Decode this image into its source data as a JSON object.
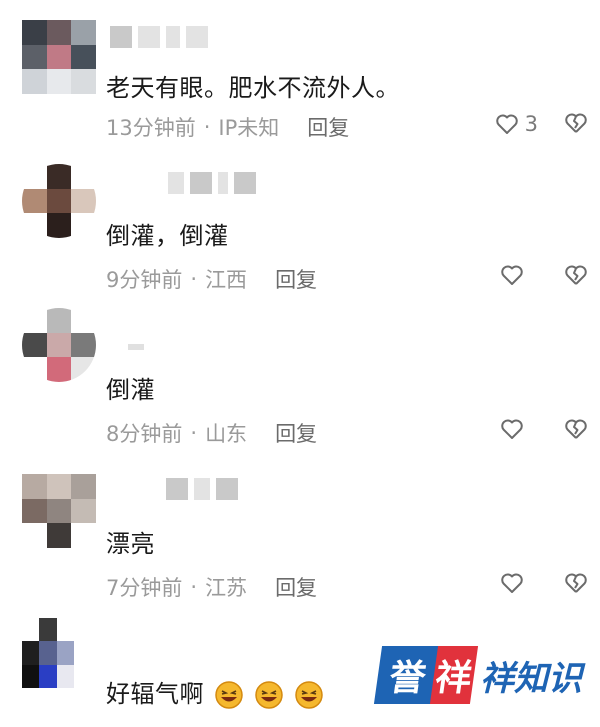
{
  "comments": [
    {
      "text": "老天有眼。肥水不流外人。",
      "time": "13分钟前",
      "location": "IP未知",
      "reply": "回复",
      "likes": "3"
    },
    {
      "text": "倒灌，倒灌",
      "time": "9分钟前",
      "location": "江西",
      "reply": "回复",
      "likes": ""
    },
    {
      "text": "倒灌",
      "time": "8分钟前",
      "location": "山东",
      "reply": "回复",
      "likes": ""
    },
    {
      "text": "漂亮",
      "time": "7分钟前",
      "location": "江苏",
      "reply": "回复",
      "likes": ""
    },
    {
      "text": "好辐气啊",
      "time": "",
      "location": "",
      "reply": "",
      "likes": ""
    }
  ],
  "separator": "·",
  "icons": {
    "like": "heart-outline-icon",
    "dislike": "broken-heart-icon",
    "emoji": "laughing-emoji-icon"
  },
  "watermark": {
    "mark1": "誉",
    "mark2": "祥",
    "text": "祥知识"
  },
  "colors": {
    "text": "#1a1a1a",
    "meta": "#9a9a9a",
    "brand_blue": "#1e64b4",
    "brand_red": "#e1323c"
  }
}
